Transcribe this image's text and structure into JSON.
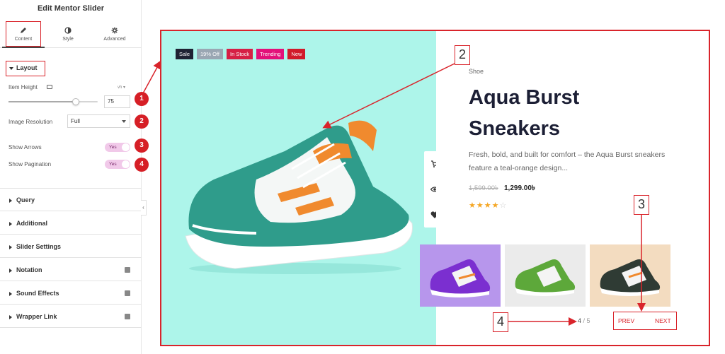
{
  "panel": {
    "title": "Edit Mentor Slider",
    "tabs": [
      {
        "label": "Content",
        "icon": "pencil-icon"
      },
      {
        "label": "Style",
        "icon": "half-circle-icon"
      },
      {
        "label": "Advanced",
        "icon": "gear-icon"
      }
    ],
    "layout_label": "Layout",
    "item_height_label": "Item Height",
    "item_height_unit": "vh",
    "item_height_value": "75",
    "item_height_level": 0.75,
    "image_resolution_label": "Image Resolution",
    "image_resolution_value": "Full",
    "show_arrows_label": "Show Arrows",
    "show_arrows_value": "Yes",
    "show_pagination_label": "Show Pagination",
    "show_pagination_value": "Yes",
    "sections": [
      {
        "label": "Query",
        "pro": false
      },
      {
        "label": "Additional",
        "pro": false
      },
      {
        "label": "Slider Settings",
        "pro": false
      },
      {
        "label": "Notation",
        "pro": true
      },
      {
        "label": "Sound Effects",
        "pro": true
      },
      {
        "label": "Wrapper Link",
        "pro": true
      }
    ],
    "markers": [
      "1",
      "2",
      "3",
      "4"
    ]
  },
  "preview": {
    "tags": [
      {
        "label": "Sale",
        "color": "#1f2233"
      },
      {
        "label": "19% Off",
        "color": "#9aa7b3"
      },
      {
        "label": "In Stock",
        "color": "#d61f45"
      },
      {
        "label": "Trending",
        "color": "#e3107a"
      },
      {
        "label": "New",
        "color": "#d11a2a"
      }
    ],
    "category": "Shoe",
    "title": "Aqua Burst Sneakers",
    "description": "Fresh, bold, and built for comfort – the Aqua Burst sneakers feature a teal-orange design...",
    "price_old": "1,599.00৳",
    "price_new": "1,299.00৳",
    "rating": 4,
    "rating_max": 5,
    "pagination_current": "4",
    "pagination_sep": " / ",
    "pagination_total": "5",
    "prev_label": "PREV",
    "next_label": "NEXT",
    "callouts": [
      "2",
      "3",
      "4"
    ],
    "colors": {
      "hero_bg": "#adf5ea",
      "accent_red": "#d9242b",
      "title": "#1c1f35"
    }
  }
}
